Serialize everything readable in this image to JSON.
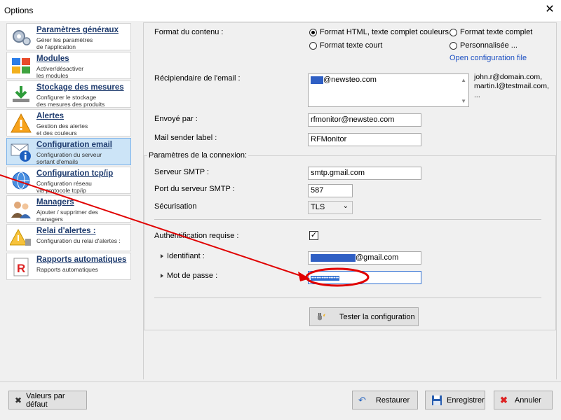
{
  "window": {
    "title": "Options",
    "close_glyph": "✕"
  },
  "sidebar": {
    "items": [
      {
        "title": "Paramètres généraux",
        "desc": "Gérer les paramètres\nde l'application",
        "icon": "gears-icon"
      },
      {
        "title": "Modules",
        "desc": "Activer/désactiver\nles modules",
        "icon": "modules-icon"
      },
      {
        "title": "Stockage des mesures",
        "desc": "Configurer le stockage\ndes mesures des produits",
        "icon": "download-icon"
      },
      {
        "title": "Alertes",
        "desc": "Gestion des alertes\net des couleurs",
        "icon": "warning-icon"
      },
      {
        "title": "Configuration email",
        "desc": "Configuration du serveur\nsortant d'emails",
        "icon": "email-icon",
        "selected": true
      },
      {
        "title": "Configuration tcp/ip",
        "desc": "Configuration réseau\nvia protocole tcp/ip",
        "icon": "network-icon"
      },
      {
        "title": "Managers",
        "desc": "Ajouter / supprimer des\nmanagers",
        "icon": "users-icon"
      },
      {
        "title": "Relai d'alertes :",
        "desc": "Configuration du relai d'alertes :",
        "icon": "relay-icon"
      },
      {
        "title": "Rapports automatiques",
        "desc": "Rapports automatiques",
        "icon": "report-icon"
      }
    ]
  },
  "content_format": {
    "label": "Format du contenu :",
    "options": [
      {
        "label": "Format HTML, texte complet couleurs",
        "checked": true
      },
      {
        "label": "Format texte complet",
        "checked": false
      },
      {
        "label": "Format texte court",
        "checked": false
      },
      {
        "label": "Personnalisée ...",
        "checked": false
      }
    ],
    "link": "Open configuration file"
  },
  "recipient": {
    "label": "Récipiendaire de l'email :",
    "value_suffix": "@newsteo.com",
    "hint": "john.r@domain.com,\nmartin.l@testmail.com,\n..."
  },
  "sender": {
    "label": "Envoyé par :",
    "value": "rfmonitor@newsteo.com"
  },
  "sender_label": {
    "label": "Mail sender label :",
    "value": "RFMonitor"
  },
  "connection": {
    "group_title": "Paramètres de la connexion:",
    "smtp_server": {
      "label": "Serveur SMTP :",
      "value": "smtp.gmail.com"
    },
    "smtp_port": {
      "label": "Port du serveur SMTP :",
      "value": "587"
    },
    "security": {
      "label": "Sécurisation",
      "value": "TLS"
    },
    "auth": {
      "label": "Authentification requise :",
      "checked": true,
      "check_glyph": "✓"
    },
    "username": {
      "label": "Identifiant :",
      "value_suffix": "@gmail.com"
    },
    "password": {
      "label": "Mot de passe :",
      "value": "••••••••••••••••"
    },
    "test_button": "Tester la configuration"
  },
  "footer": {
    "defaults": "Valeurs par défaut",
    "restore": "Restaurer",
    "save": "Enregistrer",
    "cancel": "Annuler"
  },
  "colors": {
    "accent": "#1b4fc2",
    "selected": "#cce4f7",
    "annotation": "#e00000",
    "redaction": "#2f5fc4"
  }
}
